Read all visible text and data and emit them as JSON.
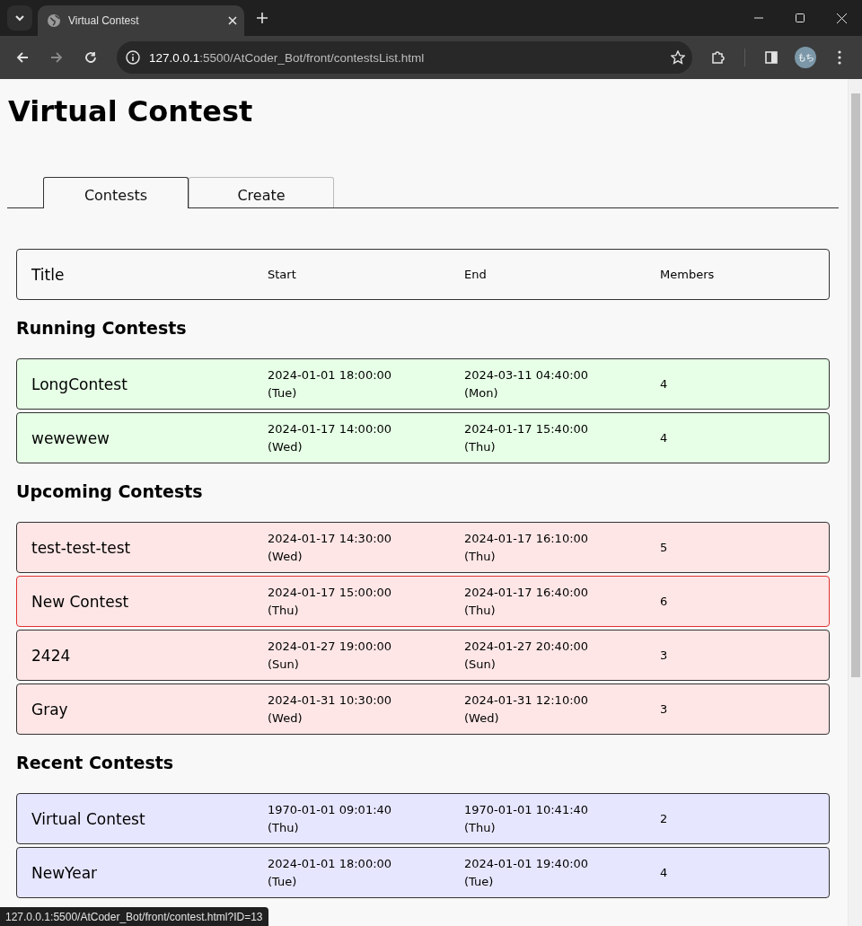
{
  "browser": {
    "tab_title": "Virtual Contest",
    "url_host": "127.0.0.1",
    "url_rest": ":5500/AtCoder_Bot/front/contestsList.html",
    "profile": "もち",
    "status_url": "127.0.0.1:5500/AtCoder_Bot/front/contest.html?ID=13"
  },
  "page": {
    "title": "Virtual Contest",
    "tabs": [
      {
        "label": "Contests",
        "selected": true
      },
      {
        "label": "Create",
        "selected": false
      }
    ],
    "header": {
      "title": "Title",
      "start": "Start",
      "end": "End",
      "members": "Members"
    },
    "sections": [
      {
        "kind": "running",
        "heading": "Running Contests",
        "contests": [
          {
            "title": "LongContest",
            "start_date": "2024-01-01 18:00:00",
            "start_day": "(Tue)",
            "end_date": "2024-03-11 04:40:00",
            "end_day": "(Mon)",
            "members": "4",
            "hovered": false
          },
          {
            "title": "wewewew",
            "start_date": "2024-01-17 14:00:00",
            "start_day": "(Wed)",
            "end_date": "2024-01-17 15:40:00",
            "end_day": "(Thu)",
            "members": "4",
            "hovered": false
          }
        ]
      },
      {
        "kind": "upcoming",
        "heading": "Upcoming Contests",
        "contests": [
          {
            "title": "test-test-test",
            "start_date": "2024-01-17 14:30:00",
            "start_day": "(Wed)",
            "end_date": "2024-01-17 16:10:00",
            "end_day": "(Thu)",
            "members": "5",
            "hovered": false
          },
          {
            "title": "New Contest",
            "start_date": "2024-01-17 15:00:00",
            "start_day": "(Thu)",
            "end_date": "2024-01-17 16:40:00",
            "end_day": "(Thu)",
            "members": "6",
            "hovered": true
          },
          {
            "title": "2424",
            "start_date": "2024-01-27 19:00:00",
            "start_day": "(Sun)",
            "end_date": "2024-01-27 20:40:00",
            "end_day": "(Sun)",
            "members": "3",
            "hovered": false
          },
          {
            "title": "Gray",
            "start_date": "2024-01-31 10:30:00",
            "start_day": "(Wed)",
            "end_date": "2024-01-31 12:10:00",
            "end_day": "(Wed)",
            "members": "3",
            "hovered": false
          }
        ]
      },
      {
        "kind": "recent",
        "heading": "Recent Contests",
        "contests": [
          {
            "title": "Virtual Contest",
            "start_date": "1970-01-01 09:01:40",
            "start_day": "(Thu)",
            "end_date": "1970-01-01 10:41:40",
            "end_day": "(Thu)",
            "members": "2",
            "hovered": false
          },
          {
            "title": "NewYear",
            "start_date": "2024-01-01 18:00:00",
            "start_day": "(Tue)",
            "end_date": "2024-01-01 19:40:00",
            "end_day": "(Tue)",
            "members": "4",
            "hovered": false
          }
        ]
      }
    ]
  }
}
